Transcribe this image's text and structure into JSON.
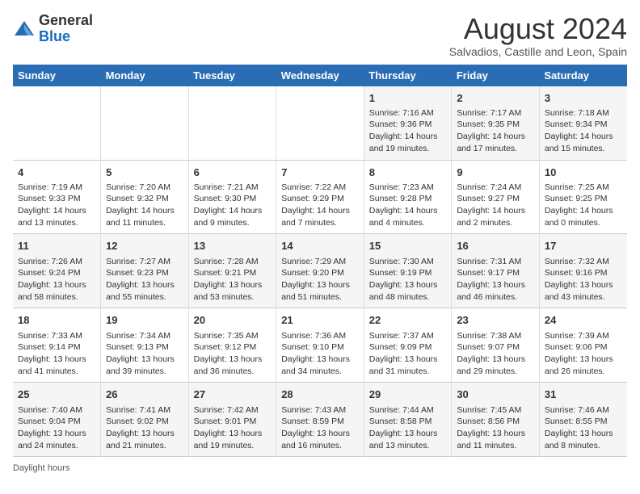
{
  "header": {
    "logo_general": "General",
    "logo_blue": "Blue",
    "month_title": "August 2024",
    "subtitle": "Salvadios, Castille and Leon, Spain"
  },
  "days_of_week": [
    "Sunday",
    "Monday",
    "Tuesday",
    "Wednesday",
    "Thursday",
    "Friday",
    "Saturday"
  ],
  "weeks": [
    [
      {
        "day": "",
        "info": ""
      },
      {
        "day": "",
        "info": ""
      },
      {
        "day": "",
        "info": ""
      },
      {
        "day": "",
        "info": ""
      },
      {
        "day": "1",
        "info": "Sunrise: 7:16 AM\nSunset: 9:36 PM\nDaylight: 14 hours and 19 minutes."
      },
      {
        "day": "2",
        "info": "Sunrise: 7:17 AM\nSunset: 9:35 PM\nDaylight: 14 hours and 17 minutes."
      },
      {
        "day": "3",
        "info": "Sunrise: 7:18 AM\nSunset: 9:34 PM\nDaylight: 14 hours and 15 minutes."
      }
    ],
    [
      {
        "day": "4",
        "info": "Sunrise: 7:19 AM\nSunset: 9:33 PM\nDaylight: 14 hours and 13 minutes."
      },
      {
        "day": "5",
        "info": "Sunrise: 7:20 AM\nSunset: 9:32 PM\nDaylight: 14 hours and 11 minutes."
      },
      {
        "day": "6",
        "info": "Sunrise: 7:21 AM\nSunset: 9:30 PM\nDaylight: 14 hours and 9 minutes."
      },
      {
        "day": "7",
        "info": "Sunrise: 7:22 AM\nSunset: 9:29 PM\nDaylight: 14 hours and 7 minutes."
      },
      {
        "day": "8",
        "info": "Sunrise: 7:23 AM\nSunset: 9:28 PM\nDaylight: 14 hours and 4 minutes."
      },
      {
        "day": "9",
        "info": "Sunrise: 7:24 AM\nSunset: 9:27 PM\nDaylight: 14 hours and 2 minutes."
      },
      {
        "day": "10",
        "info": "Sunrise: 7:25 AM\nSunset: 9:25 PM\nDaylight: 14 hours and 0 minutes."
      }
    ],
    [
      {
        "day": "11",
        "info": "Sunrise: 7:26 AM\nSunset: 9:24 PM\nDaylight: 13 hours and 58 minutes."
      },
      {
        "day": "12",
        "info": "Sunrise: 7:27 AM\nSunset: 9:23 PM\nDaylight: 13 hours and 55 minutes."
      },
      {
        "day": "13",
        "info": "Sunrise: 7:28 AM\nSunset: 9:21 PM\nDaylight: 13 hours and 53 minutes."
      },
      {
        "day": "14",
        "info": "Sunrise: 7:29 AM\nSunset: 9:20 PM\nDaylight: 13 hours and 51 minutes."
      },
      {
        "day": "15",
        "info": "Sunrise: 7:30 AM\nSunset: 9:19 PM\nDaylight: 13 hours and 48 minutes."
      },
      {
        "day": "16",
        "info": "Sunrise: 7:31 AM\nSunset: 9:17 PM\nDaylight: 13 hours and 46 minutes."
      },
      {
        "day": "17",
        "info": "Sunrise: 7:32 AM\nSunset: 9:16 PM\nDaylight: 13 hours and 43 minutes."
      }
    ],
    [
      {
        "day": "18",
        "info": "Sunrise: 7:33 AM\nSunset: 9:14 PM\nDaylight: 13 hours and 41 minutes."
      },
      {
        "day": "19",
        "info": "Sunrise: 7:34 AM\nSunset: 9:13 PM\nDaylight: 13 hours and 39 minutes."
      },
      {
        "day": "20",
        "info": "Sunrise: 7:35 AM\nSunset: 9:12 PM\nDaylight: 13 hours and 36 minutes."
      },
      {
        "day": "21",
        "info": "Sunrise: 7:36 AM\nSunset: 9:10 PM\nDaylight: 13 hours and 34 minutes."
      },
      {
        "day": "22",
        "info": "Sunrise: 7:37 AM\nSunset: 9:09 PM\nDaylight: 13 hours and 31 minutes."
      },
      {
        "day": "23",
        "info": "Sunrise: 7:38 AM\nSunset: 9:07 PM\nDaylight: 13 hours and 29 minutes."
      },
      {
        "day": "24",
        "info": "Sunrise: 7:39 AM\nSunset: 9:06 PM\nDaylight: 13 hours and 26 minutes."
      }
    ],
    [
      {
        "day": "25",
        "info": "Sunrise: 7:40 AM\nSunset: 9:04 PM\nDaylight: 13 hours and 24 minutes."
      },
      {
        "day": "26",
        "info": "Sunrise: 7:41 AM\nSunset: 9:02 PM\nDaylight: 13 hours and 21 minutes."
      },
      {
        "day": "27",
        "info": "Sunrise: 7:42 AM\nSunset: 9:01 PM\nDaylight: 13 hours and 19 minutes."
      },
      {
        "day": "28",
        "info": "Sunrise: 7:43 AM\nSunset: 8:59 PM\nDaylight: 13 hours and 16 minutes."
      },
      {
        "day": "29",
        "info": "Sunrise: 7:44 AM\nSunset: 8:58 PM\nDaylight: 13 hours and 13 minutes."
      },
      {
        "day": "30",
        "info": "Sunrise: 7:45 AM\nSunset: 8:56 PM\nDaylight: 13 hours and 11 minutes."
      },
      {
        "day": "31",
        "info": "Sunrise: 7:46 AM\nSunset: 8:55 PM\nDaylight: 13 hours and 8 minutes."
      }
    ]
  ],
  "footer": {
    "daylight_hours_label": "Daylight hours"
  }
}
